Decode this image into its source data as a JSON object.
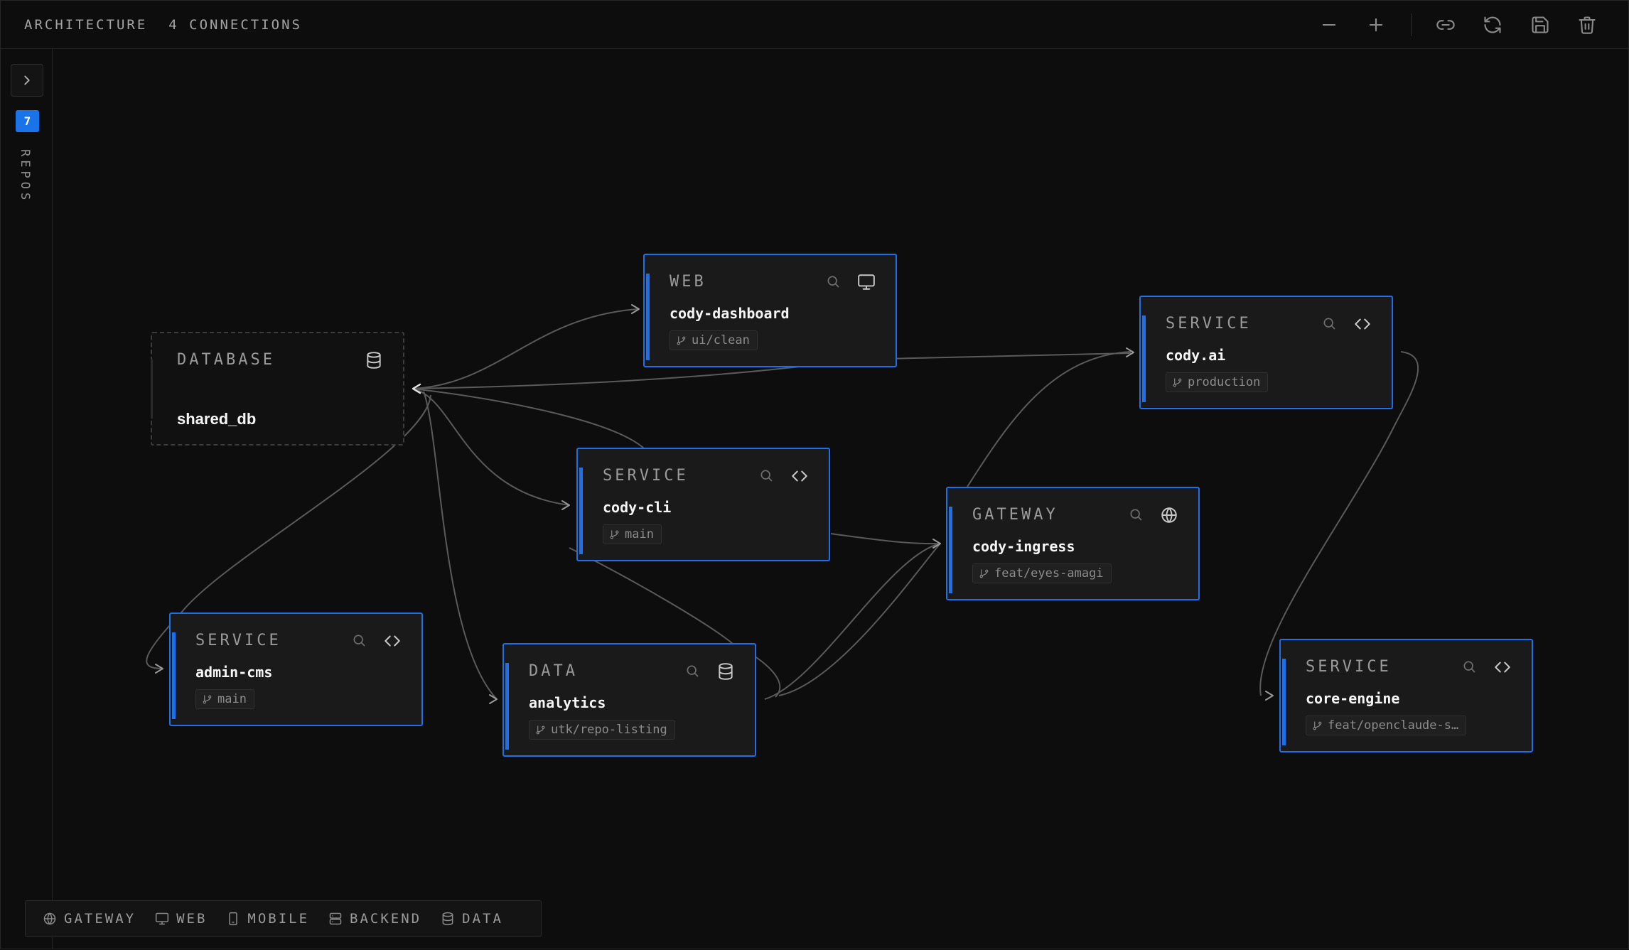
{
  "header": {
    "title": "ARCHITECTURE",
    "connections": "4 CONNECTIONS",
    "toolbar": [
      "zoom-out-icon",
      "zoom-in-icon",
      "link-icon",
      "refresh-icon",
      "save-icon",
      "trash-icon"
    ]
  },
  "sidebar": {
    "toggle_icon": "chevron-right-icon",
    "repo_count": "7",
    "label": "REPOS"
  },
  "colors": {
    "accent": "#1f6feb",
    "badge": "#1a73e8",
    "background": "#0d0d0d",
    "card": "#1a1a1a",
    "edge": "#5a5a5a"
  },
  "nodes": [
    {
      "type": "DATABASE",
      "name": "shared_db",
      "icon": "database-icon"
    },
    {
      "type": "WEB",
      "name": "cody-dashboard",
      "branch": "ui/clean",
      "icon": "monitor-icon"
    },
    {
      "type": "SERVICE",
      "name": "cody.ai",
      "branch": "production",
      "icon": "code-icon"
    },
    {
      "type": "SERVICE",
      "name": "cody-cli",
      "branch": "main",
      "icon": "code-icon"
    },
    {
      "type": "GATEWAY",
      "name": "cody-ingress",
      "branch": "feat/eyes-amagi",
      "icon": "globe-icon"
    },
    {
      "type": "SERVICE",
      "name": "admin-cms",
      "branch": "main",
      "icon": "code-icon"
    },
    {
      "type": "DATA",
      "name": "analytics",
      "branch": "utk/repo-listing",
      "icon": "database-icon"
    },
    {
      "type": "SERVICE",
      "name": "core-engine",
      "branch": "feat/openclaude-s…",
      "icon": "code-icon"
    }
  ],
  "legend": [
    {
      "label": "GATEWAY",
      "icon": "globe-icon"
    },
    {
      "label": "WEB",
      "icon": "monitor-icon"
    },
    {
      "label": "MOBILE",
      "icon": "smartphone-icon"
    },
    {
      "label": "BACKEND",
      "icon": "server-icon"
    },
    {
      "label": "DATA",
      "icon": "database-icon"
    }
  ]
}
